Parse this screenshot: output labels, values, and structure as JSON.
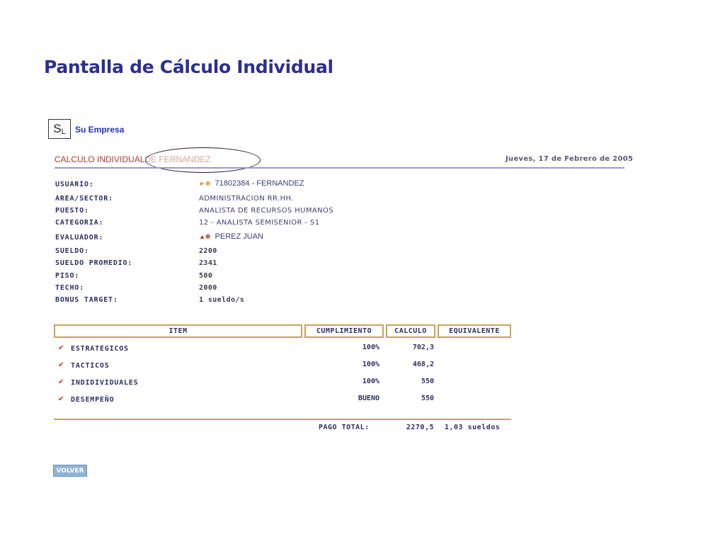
{
  "slide": {
    "title": "Pantalla de Cálculo Individual"
  },
  "brand": {
    "logo_s": "S",
    "logo_l": "L",
    "company": "Su Empresa"
  },
  "header": {
    "title_main": "CALCULO INDIVIDUAL",
    "title_dim": "DE FERNANDEZ",
    "date": "Jueves, 17 de Febrero de 2005"
  },
  "fields": {
    "usuario": {
      "label": "USUARIO:",
      "value": "71802384 - FERNANDEZ"
    },
    "area": {
      "label": "AREA/SECTOR:",
      "value": "ADMINISTRACION RR.HH."
    },
    "puesto": {
      "label": "PUESTO:",
      "value": "ANALISTA DE RECURSOS HUMANOS"
    },
    "categoria": {
      "label": "CATEGORIA:",
      "value": "12 - ANALISTA SEMISENIOR - S1"
    },
    "evaluador": {
      "label": "EVALUADOR:",
      "value": "PEREZ JUAN"
    },
    "sueldo": {
      "label": "SUELDO:",
      "value": "2200"
    },
    "sueldo_promedio": {
      "label": "SUELDO PROMEDIO:",
      "value": "2341"
    },
    "piso": {
      "label": "PISO:",
      "value": "500"
    },
    "techo": {
      "label": "TECHO:",
      "value": "2000"
    },
    "bonus_target": {
      "label": "BONUS TARGET:",
      "value": "1 sueldo/s"
    }
  },
  "table": {
    "headers": {
      "item": "ITEM",
      "cumplimiento": "CUMPLIMIENTO",
      "calculo": "CALCULO",
      "equivalente": "EQUIVALENTE"
    },
    "rows": [
      {
        "label": "ESTRATEGICOS",
        "cumplimiento": "100%",
        "calculo": "702,3"
      },
      {
        "label": "TACTICOS",
        "cumplimiento": "100%",
        "calculo": "468,2"
      },
      {
        "label": "INDIDIVIDUALES",
        "cumplimiento": "100%",
        "calculo": "550"
      },
      {
        "label": "DESEMPEÑO",
        "cumplimiento": "BUENO",
        "calculo": "550"
      }
    ],
    "footer": {
      "label": "PAGO TOTAL:",
      "total": "2270,5",
      "equivalente": "1,03 sueldos"
    }
  },
  "actions": {
    "volver": "VOLVER"
  },
  "icons": {
    "row_check": "chevron-check-icon",
    "user": "user-icon",
    "evaluator": "evaluator-icon"
  },
  "colors": {
    "title": "#2b2f8f",
    "header_red": "#b2392e",
    "table_border": "#caa45a",
    "button": "#8fb3d8"
  }
}
